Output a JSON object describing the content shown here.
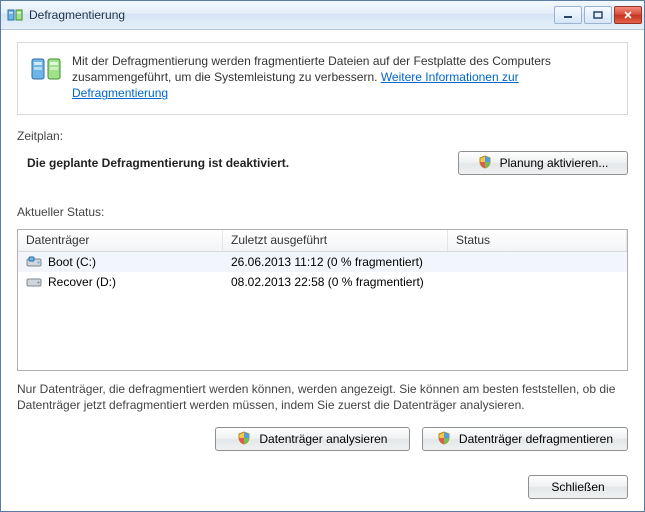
{
  "window": {
    "title": "Defragmentierung"
  },
  "info": {
    "text_1": "Mit der Defragmentierung werden fragmentierte Dateien auf der Festplatte des Computers zusammengeführt, um die Systemleistung zu verbessern. ",
    "link": "Weitere Informationen zur Defragmentierung"
  },
  "schedule": {
    "label": "Zeitplan:",
    "status": "Die geplante Defragmentierung ist deaktiviert.",
    "button": "Planung aktivieren..."
  },
  "status": {
    "label": "Aktueller Status:",
    "columns": {
      "name": "Datenträger",
      "last": "Zuletzt ausgeführt",
      "stat": "Status"
    },
    "rows": [
      {
        "icon": "disk-c",
        "name": "Boot (C:)",
        "last": "26.06.2013 11:12 (0 % fragmentiert)",
        "stat": ""
      },
      {
        "icon": "disk",
        "name": "Recover (D:)",
        "last": "08.02.2013 22:58 (0 % fragmentiert)",
        "stat": ""
      }
    ]
  },
  "hint": "Nur Datenträger, die defragmentiert werden können, werden angezeigt. Sie können am besten feststellen, ob die Datenträger jetzt defragmentiert werden müssen, indem Sie zuerst die Datenträger analysieren.",
  "actions": {
    "analyze": "Datenträger analysieren",
    "defrag": "Datenträger defragmentieren",
    "close": "Schließen"
  }
}
